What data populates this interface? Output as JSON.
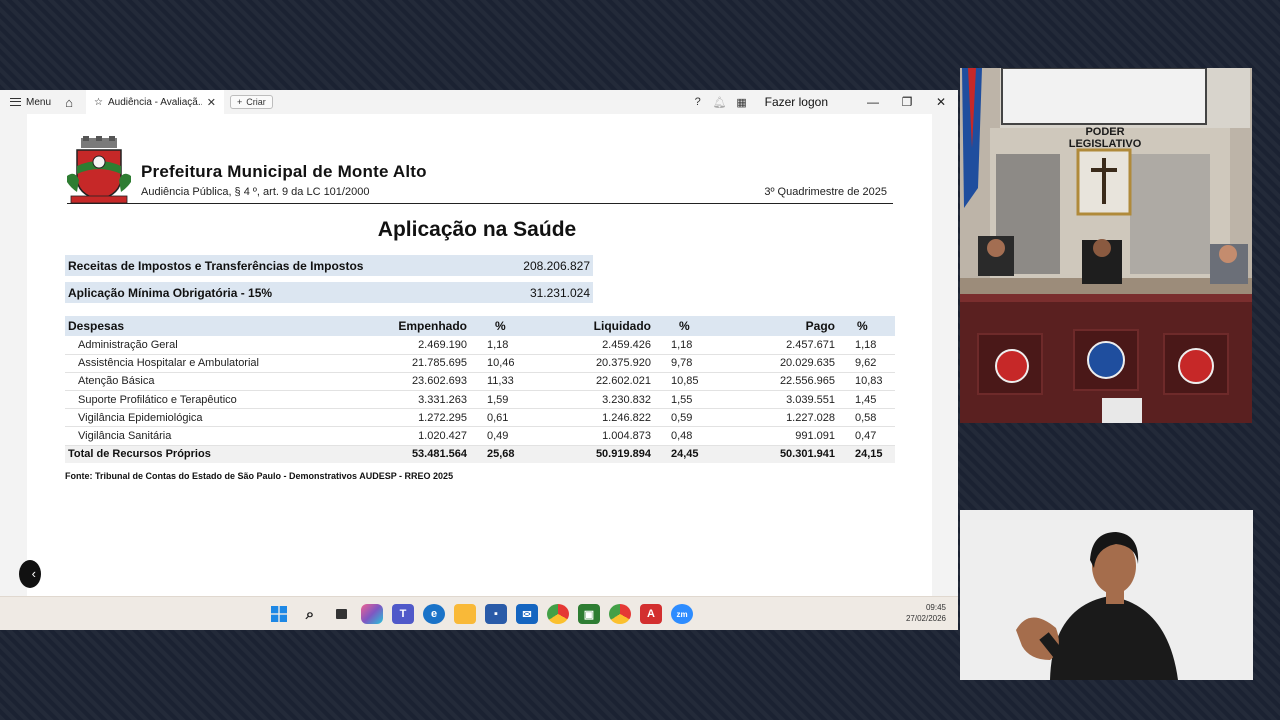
{
  "titlebar": {
    "menu_label": "Menu",
    "tab_title": "Audiência - Avaliaçã...",
    "create_label": "Criar",
    "logon_label": "Fazer logon"
  },
  "document": {
    "org_name": "Prefeitura Municipal de Monte Alto",
    "subtitle": "Audiência Pública, § 4 º, art. 9 da LC 101/2000",
    "period": "3º Quadrimestre de 2025",
    "heading": "Aplicação na Saúde",
    "summary": [
      {
        "label": "Receitas de Impostos e Transferências de Impostos",
        "value": "208.206.827"
      },
      {
        "label": "Aplicação Mínima Obrigatória - 15%",
        "value": "31.231.024"
      }
    ],
    "table": {
      "headers": [
        "Despesas",
        "Empenhado",
        "%",
        "Liquidado",
        "%",
        "Pago",
        "%"
      ],
      "rows": [
        [
          "Administração Geral",
          "2.469.190",
          "1,18",
          "2.459.426",
          "1,18",
          "2.457.671",
          "1,18"
        ],
        [
          "Assistência Hospitalar e Ambulatorial",
          "21.785.695",
          "10,46",
          "20.375.920",
          "9,78",
          "20.029.635",
          "9,62"
        ],
        [
          "Atenção Básica",
          "23.602.693",
          "11,33",
          "22.602.021",
          "10,85",
          "22.556.965",
          "10,83"
        ],
        [
          "Suporte Profilático e Terapêutico",
          "3.331.263",
          "1,59",
          "3.230.832",
          "1,55",
          "3.039.551",
          "1,45"
        ],
        [
          "Vigilância Epidemiológica",
          "1.272.295",
          "0,61",
          "1.246.822",
          "0,59",
          "1.227.028",
          "0,58"
        ],
        [
          "Vigilância Sanitária",
          "1.020.427",
          "0,49",
          "1.004.873",
          "0,48",
          "991.091",
          "0,47"
        ]
      ],
      "total": [
        "Total de Recursos Próprios",
        "53.481.564",
        "25,68",
        "50.919.894",
        "24,45",
        "50.301.941",
        "24,15"
      ]
    },
    "source": "Fonte: Tribunal de Contas do Estado de São Paulo - Demonstrativos AUDESP - RREO 2025"
  },
  "taskbar": {
    "time": "09:45",
    "date": "27/02/2026",
    "zoom_label": "zm"
  },
  "camera": {
    "sign_text": "PODER LEGISLATIVO"
  },
  "colors": {
    "header_fill": "#dce6f1",
    "edge_icon": "#1a73c8",
    "acrobat": "#d32f2f"
  }
}
